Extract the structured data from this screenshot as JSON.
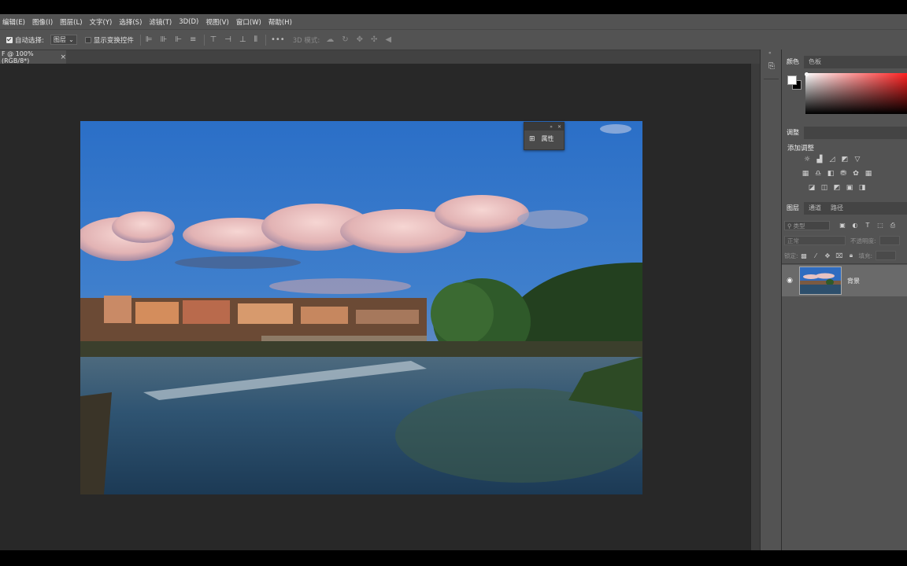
{
  "menubar": {
    "items": [
      "编辑(E)",
      "图像(I)",
      "图层(L)",
      "文字(Y)",
      "选择(S)",
      "滤镜(T)",
      "3D(D)",
      "视图(V)",
      "窗口(W)",
      "帮助(H)"
    ]
  },
  "options_bar": {
    "auto_select_label": "自动选择:",
    "auto_select_checked": true,
    "auto_select_value": "图层",
    "transform_controls_label": "显示变换控件",
    "transform_controls_checked": false,
    "more_label": "•••",
    "mode_3d_label": "3D 模式:"
  },
  "document_tab": {
    "title": "F @ 100%(RGB/8*)",
    "close_glyph": "×"
  },
  "properties_panel": {
    "label": "属性"
  },
  "color_panel": {
    "tabs": [
      "颜色",
      "色板"
    ],
    "foreground": "#ffffff",
    "background": "#000000"
  },
  "adjustments_panel": {
    "tab": "调整",
    "add_label": "添加调整"
  },
  "layers_panel": {
    "tabs": [
      "图层",
      "通道",
      "路径"
    ],
    "search_placeholder": "类型",
    "blend_mode": "正常",
    "opacity_label": "不透明度:",
    "lock_label": "锁定:",
    "fill_label": "填充:",
    "layers": [
      {
        "name": "背景",
        "visible": true,
        "selected": true
      }
    ]
  },
  "colors": {
    "menubar_bg": "#535353",
    "workspace_bg": "#282828",
    "panel_bg": "#535353",
    "selected_layer_bg": "#6a6a6a"
  }
}
